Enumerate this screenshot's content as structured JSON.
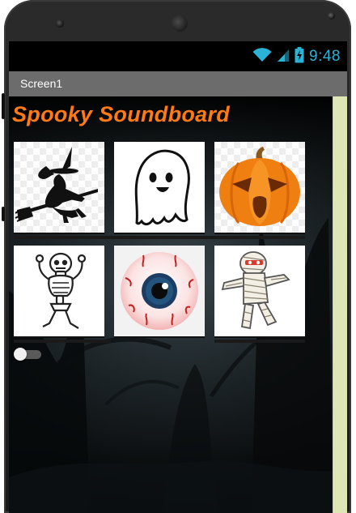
{
  "status_bar": {
    "time": "9:48",
    "icons": [
      "wifi-icon",
      "cell-signal-icon",
      "battery-charging-icon"
    ],
    "accent": "#2ab3d6"
  },
  "titlebar": {
    "title": "Screen1"
  },
  "app": {
    "title": "Spooky Soundboard",
    "title_color": "#ff7a14",
    "buttons": [
      {
        "name": "witch",
        "icon": "witch-icon"
      },
      {
        "name": "ghost",
        "icon": "ghost-icon"
      },
      {
        "name": "pumpkin",
        "icon": "pumpkin-icon"
      },
      {
        "name": "skeleton",
        "icon": "skeleton-icon"
      },
      {
        "name": "eyeball",
        "icon": "eyeball-icon"
      },
      {
        "name": "mummy",
        "icon": "mummy-icon"
      }
    ],
    "switch": {
      "state": "off"
    }
  },
  "colors": {
    "titlebar": "#6c6c6c",
    "scroll_track": "#dfe6b5",
    "background": "#000000"
  }
}
